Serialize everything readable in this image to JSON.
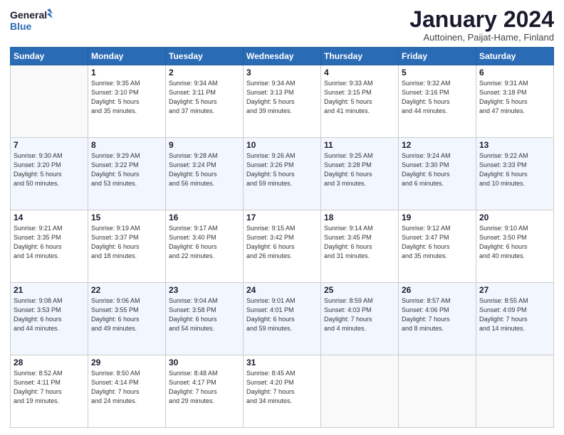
{
  "logo": {
    "line1": "General",
    "line2": "Blue"
  },
  "header": {
    "month": "January 2024",
    "location": "Auttoinen, Paijat-Hame, Finland"
  },
  "weekdays": [
    "Sunday",
    "Monday",
    "Tuesday",
    "Wednesday",
    "Thursday",
    "Friday",
    "Saturday"
  ],
  "weeks": [
    [
      {
        "day": "",
        "info": ""
      },
      {
        "day": "1",
        "info": "Sunrise: 9:35 AM\nSunset: 3:10 PM\nDaylight: 5 hours\nand 35 minutes."
      },
      {
        "day": "2",
        "info": "Sunrise: 9:34 AM\nSunset: 3:11 PM\nDaylight: 5 hours\nand 37 minutes."
      },
      {
        "day": "3",
        "info": "Sunrise: 9:34 AM\nSunset: 3:13 PM\nDaylight: 5 hours\nand 39 minutes."
      },
      {
        "day": "4",
        "info": "Sunrise: 9:33 AM\nSunset: 3:15 PM\nDaylight: 5 hours\nand 41 minutes."
      },
      {
        "day": "5",
        "info": "Sunrise: 9:32 AM\nSunset: 3:16 PM\nDaylight: 5 hours\nand 44 minutes."
      },
      {
        "day": "6",
        "info": "Sunrise: 9:31 AM\nSunset: 3:18 PM\nDaylight: 5 hours\nand 47 minutes."
      }
    ],
    [
      {
        "day": "7",
        "info": "Sunrise: 9:30 AM\nSunset: 3:20 PM\nDaylight: 5 hours\nand 50 minutes."
      },
      {
        "day": "8",
        "info": "Sunrise: 9:29 AM\nSunset: 3:22 PM\nDaylight: 5 hours\nand 53 minutes."
      },
      {
        "day": "9",
        "info": "Sunrise: 9:28 AM\nSunset: 3:24 PM\nDaylight: 5 hours\nand 56 minutes."
      },
      {
        "day": "10",
        "info": "Sunrise: 9:26 AM\nSunset: 3:26 PM\nDaylight: 5 hours\nand 59 minutes."
      },
      {
        "day": "11",
        "info": "Sunrise: 9:25 AM\nSunset: 3:28 PM\nDaylight: 6 hours\nand 3 minutes."
      },
      {
        "day": "12",
        "info": "Sunrise: 9:24 AM\nSunset: 3:30 PM\nDaylight: 6 hours\nand 6 minutes."
      },
      {
        "day": "13",
        "info": "Sunrise: 9:22 AM\nSunset: 3:33 PM\nDaylight: 6 hours\nand 10 minutes."
      }
    ],
    [
      {
        "day": "14",
        "info": "Sunrise: 9:21 AM\nSunset: 3:35 PM\nDaylight: 6 hours\nand 14 minutes."
      },
      {
        "day": "15",
        "info": "Sunrise: 9:19 AM\nSunset: 3:37 PM\nDaylight: 6 hours\nand 18 minutes."
      },
      {
        "day": "16",
        "info": "Sunrise: 9:17 AM\nSunset: 3:40 PM\nDaylight: 6 hours\nand 22 minutes."
      },
      {
        "day": "17",
        "info": "Sunrise: 9:15 AM\nSunset: 3:42 PM\nDaylight: 6 hours\nand 26 minutes."
      },
      {
        "day": "18",
        "info": "Sunrise: 9:14 AM\nSunset: 3:45 PM\nDaylight: 6 hours\nand 31 minutes."
      },
      {
        "day": "19",
        "info": "Sunrise: 9:12 AM\nSunset: 3:47 PM\nDaylight: 6 hours\nand 35 minutes."
      },
      {
        "day": "20",
        "info": "Sunrise: 9:10 AM\nSunset: 3:50 PM\nDaylight: 6 hours\nand 40 minutes."
      }
    ],
    [
      {
        "day": "21",
        "info": "Sunrise: 9:08 AM\nSunset: 3:53 PM\nDaylight: 6 hours\nand 44 minutes."
      },
      {
        "day": "22",
        "info": "Sunrise: 9:06 AM\nSunset: 3:55 PM\nDaylight: 6 hours\nand 49 minutes."
      },
      {
        "day": "23",
        "info": "Sunrise: 9:04 AM\nSunset: 3:58 PM\nDaylight: 6 hours\nand 54 minutes."
      },
      {
        "day": "24",
        "info": "Sunrise: 9:01 AM\nSunset: 4:01 PM\nDaylight: 6 hours\nand 59 minutes."
      },
      {
        "day": "25",
        "info": "Sunrise: 8:59 AM\nSunset: 4:03 PM\nDaylight: 7 hours\nand 4 minutes."
      },
      {
        "day": "26",
        "info": "Sunrise: 8:57 AM\nSunset: 4:06 PM\nDaylight: 7 hours\nand 8 minutes."
      },
      {
        "day": "27",
        "info": "Sunrise: 8:55 AM\nSunset: 4:09 PM\nDaylight: 7 hours\nand 14 minutes."
      }
    ],
    [
      {
        "day": "28",
        "info": "Sunrise: 8:52 AM\nSunset: 4:11 PM\nDaylight: 7 hours\nand 19 minutes."
      },
      {
        "day": "29",
        "info": "Sunrise: 8:50 AM\nSunset: 4:14 PM\nDaylight: 7 hours\nand 24 minutes."
      },
      {
        "day": "30",
        "info": "Sunrise: 8:48 AM\nSunset: 4:17 PM\nDaylight: 7 hours\nand 29 minutes."
      },
      {
        "day": "31",
        "info": "Sunrise: 8:45 AM\nSunset: 4:20 PM\nDaylight: 7 hours\nand 34 minutes."
      },
      {
        "day": "",
        "info": ""
      },
      {
        "day": "",
        "info": ""
      },
      {
        "day": "",
        "info": ""
      }
    ]
  ]
}
